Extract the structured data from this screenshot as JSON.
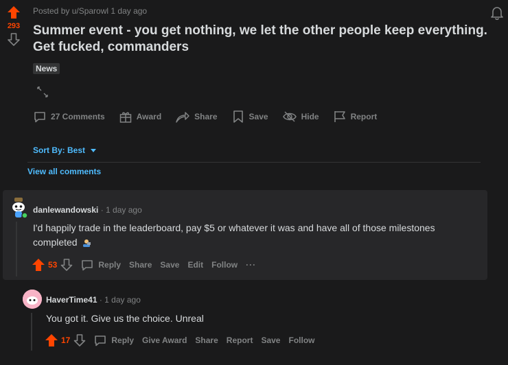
{
  "post": {
    "vote_count": "293",
    "meta": "Posted by u/Sparowl 1 day ago",
    "title_line1": "Summer event - you get nothing, we let the other people keep everything.",
    "title_line2": "Get fucked, commanders",
    "flair": "News",
    "actions": {
      "comments": "27 Comments",
      "award": "Award",
      "share": "Share",
      "save": "Save",
      "hide": "Hide",
      "report": "Report"
    }
  },
  "sort": {
    "label": "Sort By: Best"
  },
  "view_all": "View all comments",
  "comments": [
    {
      "user": "danlewandowski",
      "time": "· 1 day ago",
      "body_line1": "I'd happily trade in the leaderboard, pay $5 or whatever it was and have all of those milestones",
      "body_line2": "completed",
      "votes": "53",
      "actions": {
        "reply": "Reply",
        "share": "Share",
        "save": "Save",
        "edit": "Edit",
        "follow": "Follow",
        "more": "···"
      }
    },
    {
      "user": "HaverTime41",
      "time": "· 1 day ago",
      "body_line1": "You got it. Give us the choice. Unreal",
      "votes": "17",
      "actions": {
        "reply": "Reply",
        "give_award": "Give Award",
        "share": "Share",
        "report": "Report",
        "save": "Save",
        "follow": "Follow"
      }
    }
  ],
  "colors": {
    "upvote": "#ff4500",
    "link": "#4fbcff",
    "muted": "#818384",
    "bg": "#1a1a1b",
    "card": "#272729"
  }
}
